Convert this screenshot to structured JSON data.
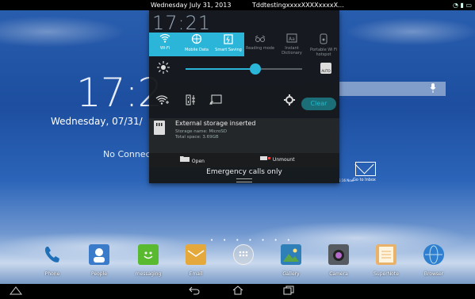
{
  "statusbar": {
    "date": "Wednesday July 31, 2013",
    "title": "TddtestingxxxxXXXXxxxxX..."
  },
  "home": {
    "clock": "17:2",
    "date": "Wednesday, 07/31/",
    "no_connection": "No Connec",
    "inbox_small": "5:16 Now",
    "inbox_label": "Go to Inbox",
    "dock": [
      {
        "label": "Phone",
        "icon": "phone-icon",
        "color": "#1e6fb8"
      },
      {
        "label": "People",
        "icon": "people-icon",
        "color": "#3a7cc9"
      },
      {
        "label": "messaging",
        "icon": "messaging-icon",
        "color": "#5aba2f"
      },
      {
        "label": "Email",
        "icon": "email-icon",
        "color": "#e5a83a"
      },
      {
        "label": "",
        "icon": "app-drawer-icon",
        "color": "#c7cdd3"
      },
      {
        "label": "Gallery",
        "icon": "gallery-icon",
        "color": "#5aa548"
      },
      {
        "label": "Camera",
        "icon": "camera-icon",
        "color": "#555b60"
      },
      {
        "label": "SuperNote",
        "icon": "supernote-icon",
        "color": "#e8b26a"
      },
      {
        "label": "Browser",
        "icon": "browser-icon",
        "color": "#2f7fd0"
      }
    ]
  },
  "panel": {
    "time": "17:21",
    "tiles": [
      {
        "label": "Wi-Fi",
        "icon": "wifi-icon",
        "on": true
      },
      {
        "label": "Mobile Data",
        "icon": "mobile-data-icon",
        "on": true
      },
      {
        "label": "Smart Saving",
        "icon": "smart-saving-icon",
        "on": true
      },
      {
        "label": "Reading mode",
        "icon": "reading-mode-icon",
        "on": false
      },
      {
        "label": "Instant Dictionary",
        "icon": "instant-dictionary-icon",
        "on": false
      },
      {
        "label": "Portable Wi Fi hotspot",
        "icon": "hotspot-icon",
        "on": false
      }
    ],
    "brightness_percent": 60,
    "brightness_auto_label": "AUTO",
    "clear_label": "Clear",
    "notification": {
      "title": "External storage inserted",
      "line1": "Storage name: MicroSD",
      "line2": "Total space: 3.69GB",
      "open_label": "Open",
      "unmount_label": "Unmount"
    },
    "emergency": "Emergency calls only"
  },
  "colors": {
    "accent": "#2bb6d9"
  }
}
